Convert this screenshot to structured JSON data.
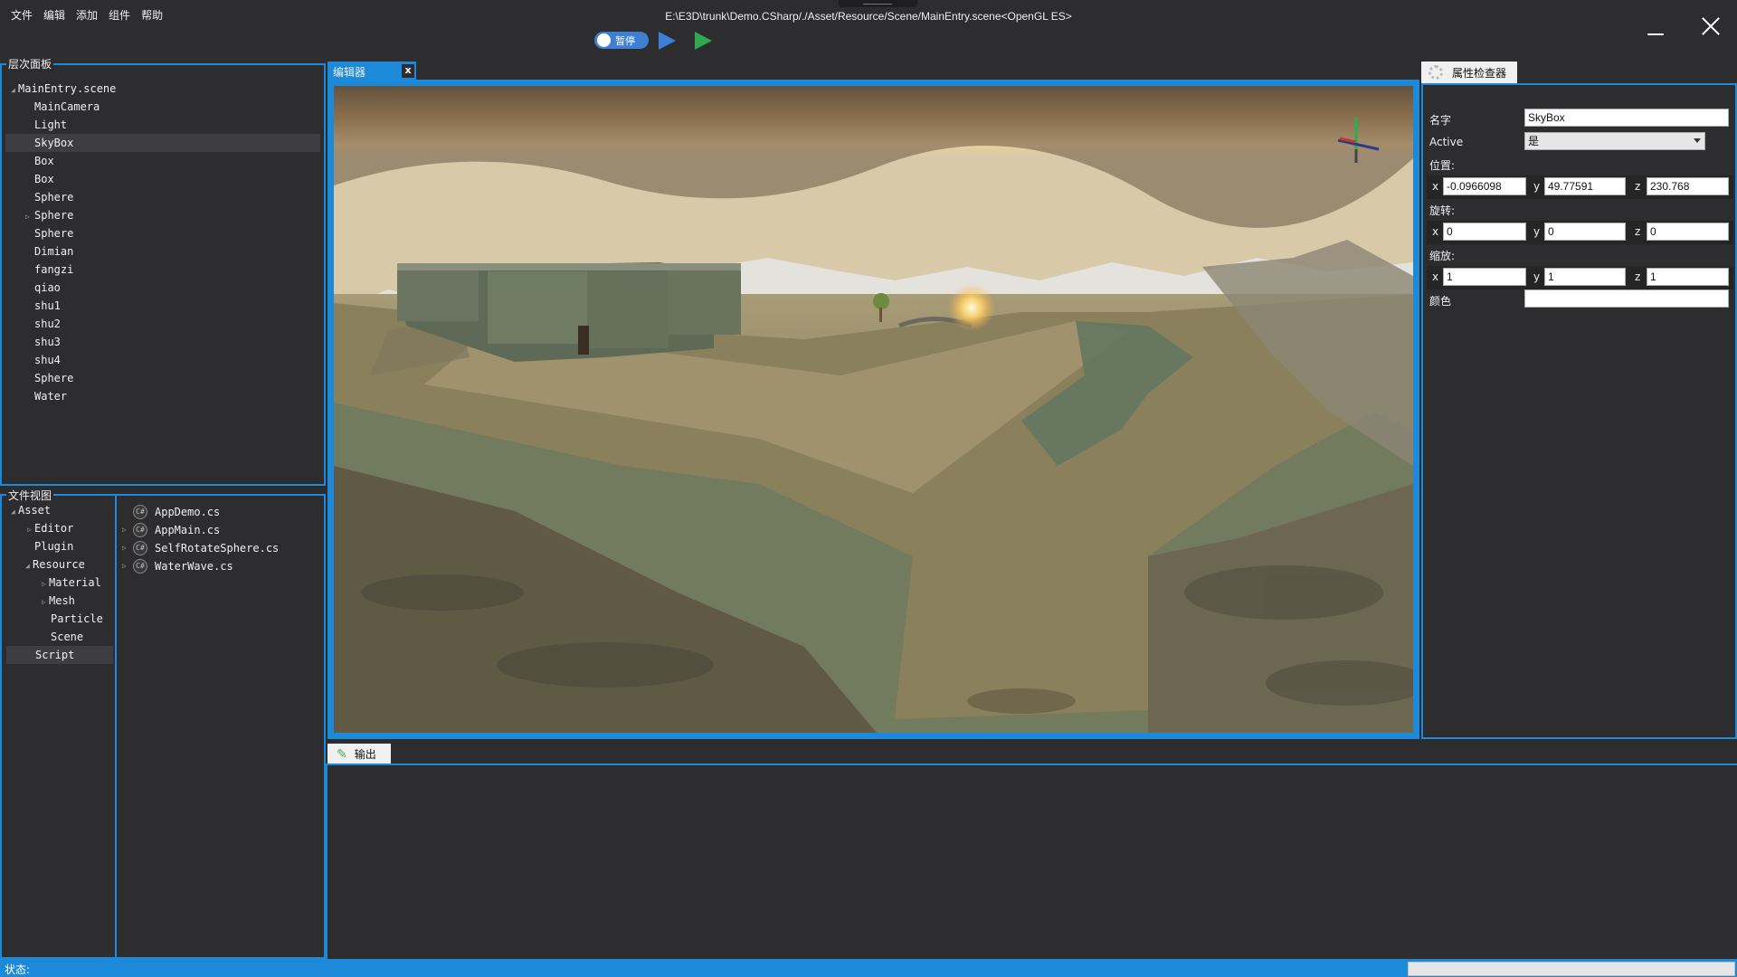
{
  "menu": [
    "文件",
    "编辑",
    "添加",
    "组件",
    "帮助"
  ],
  "window_title": "E:\\E3D\\trunk\\Demo.CSharp/./Asset/Resource/Scene/MainEntry.scene<OpenGL ES>",
  "toolbar": {
    "pause_label": "暂停"
  },
  "hierarchy": {
    "title": "层次面板",
    "root": "MainEntry.scene",
    "items": [
      "MainCamera",
      "Light",
      "SkyBox",
      "Box",
      "Box",
      "Sphere",
      "Sphere",
      "Sphere",
      "Dimian",
      "fangzi",
      "qiao",
      "shu1",
      "shu2",
      "shu3",
      "shu4",
      "Sphere",
      "Water"
    ],
    "selected": "SkyBox"
  },
  "fileview": {
    "title": "文件视图",
    "tree": {
      "asset": "Asset",
      "editor": "Editor",
      "plugin": "Plugin",
      "resource": "Resource",
      "material": "Material",
      "mesh": "Mesh",
      "particle": "Particle",
      "scene": "Scene",
      "script": "Script"
    },
    "files": [
      "AppDemo.cs",
      "AppMain.cs",
      "SelfRotateSphere.cs",
      "WaterWave.cs"
    ],
    "selected": "Script"
  },
  "editor": {
    "tab_label": "编辑器",
    "close_label": "x"
  },
  "inspector": {
    "tab_label": "属性检查器",
    "name_label": "名字",
    "name_value": "SkyBox",
    "active_label": "Active",
    "active_value": "是",
    "position_label": "位置:",
    "position": {
      "x": "-0.0966098",
      "y": "49.77591",
      "z": "230.768"
    },
    "rotation_label": "旋转:",
    "rotation": {
      "x": "0",
      "y": "0",
      "z": "0"
    },
    "scale_label": "缩放:",
    "scale": {
      "x": "1",
      "y": "1",
      "z": "1"
    },
    "color_label": "颜色",
    "color_value": "",
    "axis_x": "x",
    "axis_y": "y",
    "axis_z": "z"
  },
  "output": {
    "tab_label": "输出"
  },
  "status": {
    "label": "状态:"
  },
  "colors": {
    "accent": "#1c8ad9",
    "panel_bg": "#2d2d30",
    "selected_bg": "#3e3e42"
  }
}
